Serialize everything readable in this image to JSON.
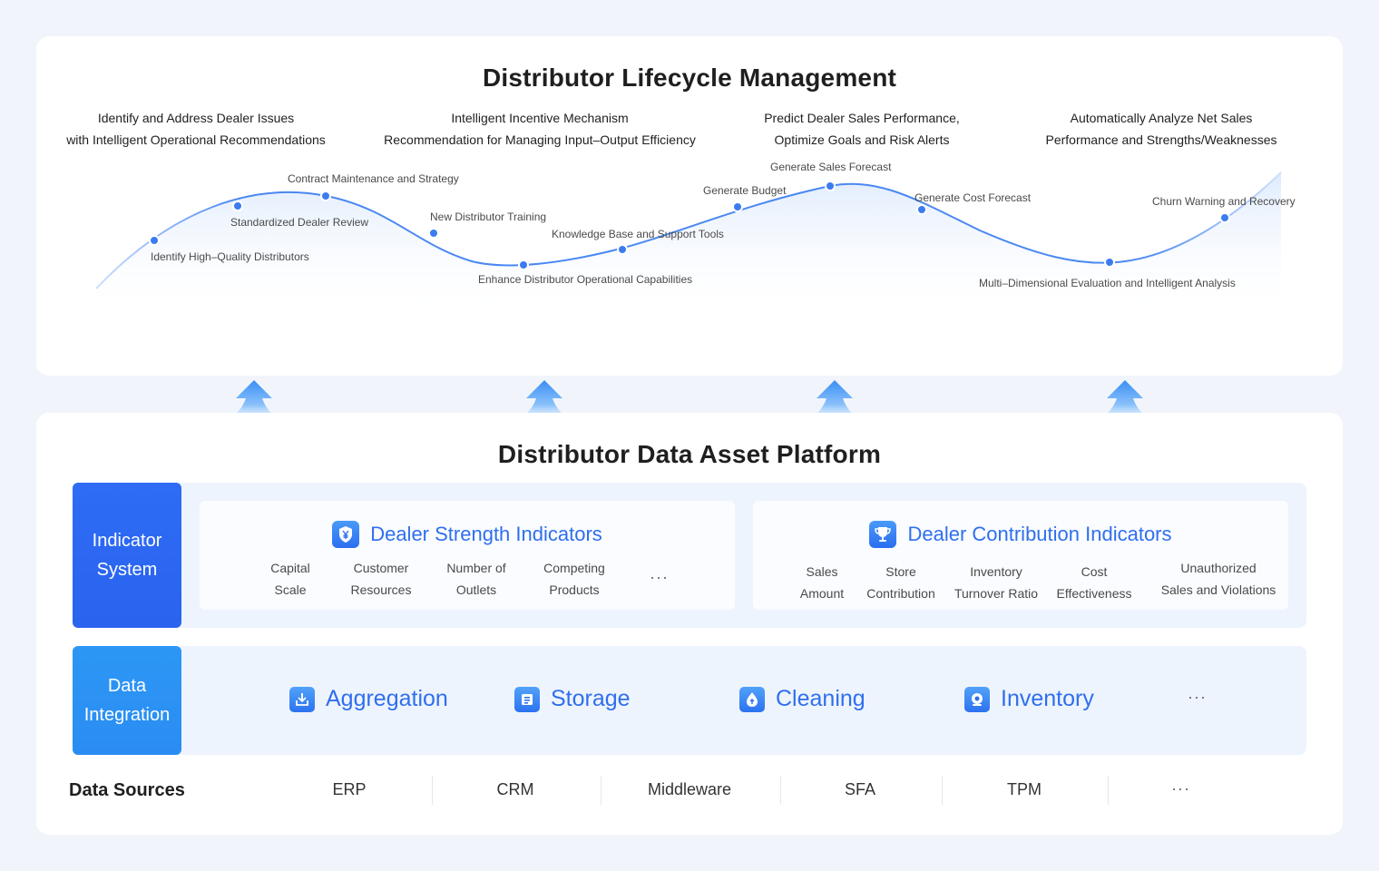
{
  "lifecycle": {
    "title": "Distributor Lifecycle Management",
    "phases": [
      {
        "line1": "Identify and Address Dealer Issues",
        "line2": "with Intelligent Operational Recommendations"
      },
      {
        "line1": "Intelligent Incentive Mechanism",
        "line2": "Recommendation for Managing Input–Output Efficiency"
      },
      {
        "line1": "Predict Dealer Sales Performance,",
        "line2": "Optimize Goals and Risk Alerts"
      },
      {
        "line1": "Automatically Analyze Net Sales",
        "line2": "Performance and Strengths/Weaknesses"
      }
    ],
    "milestones": [
      "Identify High–Quality Distributors",
      "Standardized Dealer Review",
      "Contract Maintenance and Strategy",
      "New Distributor Training",
      "Enhance Distributor Operational Capabilities",
      "Knowledge Base and Support Tools",
      "Generate Budget",
      "Generate Sales Forecast",
      "Generate Cost Forecast",
      "Multi–Dimensional Evaluation and Intelligent Analysis",
      "Churn Warning and Recovery"
    ],
    "accent_color": "#3b7cf0"
  },
  "platform": {
    "title": "Distributor Data Asset Platform",
    "indicator_system": {
      "label_line1": "Indicator",
      "label_line2": "System",
      "strength": {
        "title": "Dealer Strength Indicators",
        "icon": "yen-shield-icon",
        "items": [
          {
            "line1": "Capital",
            "line2": "Scale"
          },
          {
            "line1": "Customer",
            "line2": "Resources"
          },
          {
            "line1": "Number of",
            "line2": "Outlets"
          },
          {
            "line1": "Competing",
            "line2": "Products"
          }
        ],
        "more": "···"
      },
      "contribution": {
        "title": "Dealer Contribution Indicators",
        "icon": "trophy-icon",
        "items": [
          {
            "line1": "Sales",
            "line2": "Amount"
          },
          {
            "line1": "Store",
            "line2": "Contribution"
          },
          {
            "line1": "Inventory",
            "line2": "Turnover Ratio"
          },
          {
            "line1": "Cost",
            "line2": "Effectiveness"
          },
          {
            "line1": "Unauthorized",
            "line2": "Sales and Violations"
          }
        ]
      }
    },
    "data_integration": {
      "label_line1": "Data",
      "label_line2": "Integration",
      "items": [
        {
          "label": "Aggregation",
          "icon": "aggregation-icon"
        },
        {
          "label": "Storage",
          "icon": "storage-icon"
        },
        {
          "label": "Cleaning",
          "icon": "cleaning-icon"
        },
        {
          "label": "Inventory",
          "icon": "inventory-icon"
        }
      ],
      "more": "···"
    },
    "data_sources": {
      "label": "Data Sources",
      "items": [
        "ERP",
        "CRM",
        "Middleware",
        "SFA",
        "TPM"
      ],
      "more": "···"
    }
  }
}
